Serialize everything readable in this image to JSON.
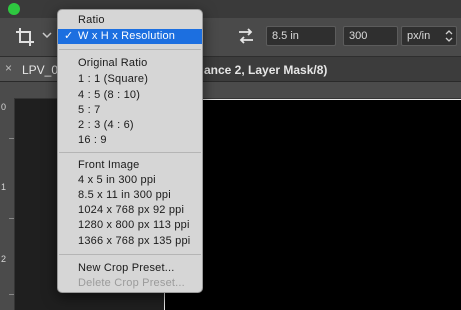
{
  "options_bar": {
    "crop_tool_icon": "crop-icon",
    "swap_icon": "swap-arrows-icon",
    "height_value": "8.5 in",
    "resolution_value": "300",
    "unit_value": "px/in"
  },
  "tab": {
    "close_glyph": "×",
    "title_start": "LPV_0",
    "title_end": "ance 2, Layer Mask/8)"
  },
  "ruler_left": {
    "labels": [
      "0",
      "1",
      "2"
    ]
  },
  "menu": {
    "items": [
      {
        "label": "Ratio",
        "state": "normal"
      },
      {
        "label": "W x H x Resolution",
        "state": "selected",
        "check": "✓"
      },
      {
        "label": "Original Ratio",
        "state": "normal"
      },
      {
        "label": "1 : 1 (Square)",
        "state": "normal"
      },
      {
        "label": "4 : 5 (8 : 10)",
        "state": "normal"
      },
      {
        "label": "5 : 7",
        "state": "normal"
      },
      {
        "label": "2 : 3 (4 : 6)",
        "state": "normal"
      },
      {
        "label": "16 : 9",
        "state": "normal"
      },
      {
        "label": "Front Image",
        "state": "normal"
      },
      {
        "label": "4 x 5 in 300 ppi",
        "state": "normal"
      },
      {
        "label": "8.5 x 11 in 300 ppi",
        "state": "normal"
      },
      {
        "label": "1024 x 768 px 92 ppi",
        "state": "normal"
      },
      {
        "label": "1280 x 800 px 113 ppi",
        "state": "normal"
      },
      {
        "label": "1366 x 768 px 135 ppi",
        "state": "normal"
      },
      {
        "label": "New Crop Preset...",
        "state": "normal"
      },
      {
        "label": "Delete Crop Preset...",
        "state": "disabled"
      }
    ]
  },
  "colors": {
    "selection": "#1c6fe0",
    "menu_bg": "#d6d6d6",
    "toolbar_bg": "#4a4a4a",
    "canvas": "#000000"
  }
}
